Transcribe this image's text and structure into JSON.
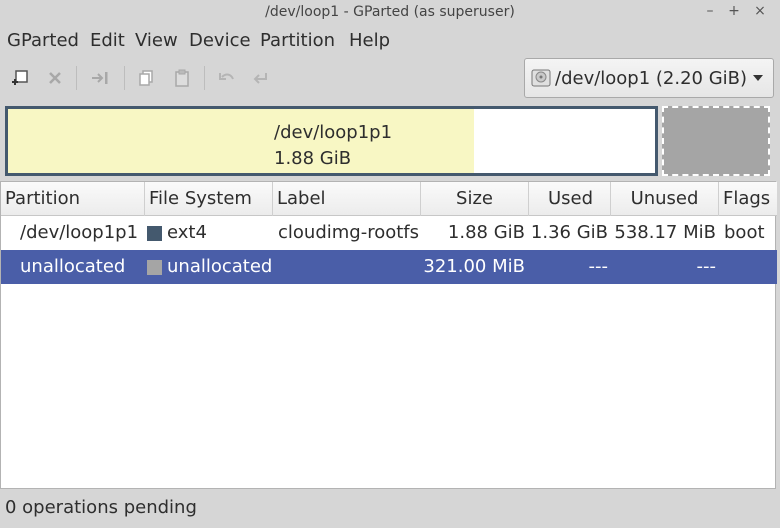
{
  "window": {
    "title": "/dev/loop1 - GParted (as superuser)",
    "controls": [
      "–",
      "+",
      "×"
    ]
  },
  "menu": [
    "GParted",
    "Edit",
    "View",
    "Device",
    "Partition",
    "Help"
  ],
  "toolbar": {
    "buttons": [
      "new-partition-icon",
      "delete-icon",
      "resize-move-icon",
      "copy-icon",
      "paste-icon",
      "undo-icon",
      "apply-icon"
    ]
  },
  "device_selector": {
    "text": "/dev/loop1  (2.20 GiB)",
    "icon": "disk-drive-icon"
  },
  "partition_map": {
    "name": "/dev/loop1p1",
    "size": "1.88 GiB",
    "used_fraction": 0.72,
    "colors": {
      "ext4": "#44596e",
      "used": "#f8f7c4",
      "unallocated": "#a5a5a5"
    }
  },
  "table": {
    "columns": [
      "Partition",
      "File System",
      "Label",
      "Size",
      "Used",
      "Unused",
      "Flags"
    ],
    "rows": [
      {
        "partition": "/dev/loop1p1",
        "fs": "ext4",
        "label": "cloudimg-rootfs",
        "size": "1.88 GiB",
        "used": "1.36 GiB",
        "unused": "538.17 MiB",
        "flags": "boot",
        "fs_color": "#44596e",
        "selected": false
      },
      {
        "partition": "unallocated",
        "fs": "unallocated",
        "label": "",
        "size": "321.00 MiB",
        "used": "---",
        "unused": "---",
        "flags": "",
        "fs_color": "#a5a5a5",
        "selected": true
      }
    ],
    "selection_color": "#4a5ea8"
  },
  "status": {
    "text": "0 operations pending"
  }
}
